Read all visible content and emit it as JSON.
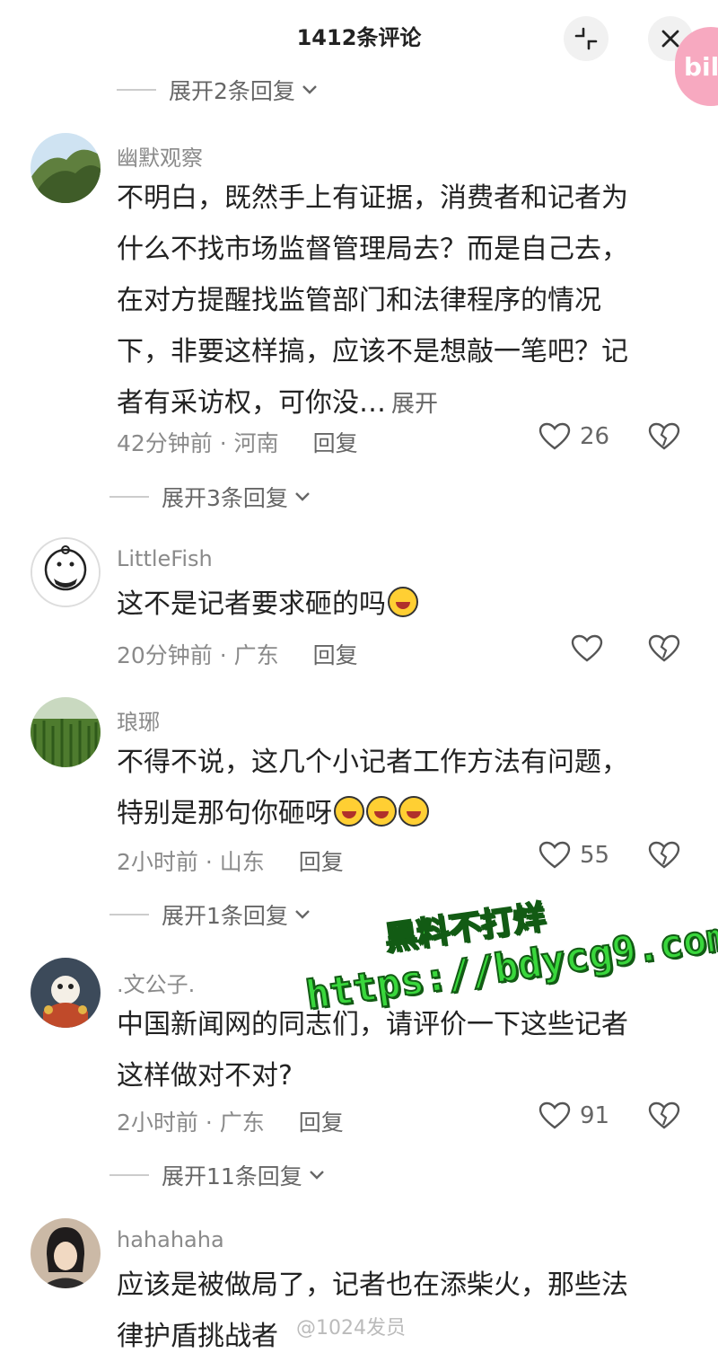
{
  "header": {
    "title": "1412条评论",
    "bili_badge": "bili"
  },
  "expand_labels": [
    "展开2条回复",
    "展开3条回复",
    "展开1条回复",
    "展开11条回复"
  ],
  "comments": [
    {
      "username": "幽默观察",
      "lines": [
        "不明白，既然手上有证据，消费者和记者为",
        "什么不找市场监督管理局去？而是自己去，",
        "在对方提醒找监管部门和法律程序的情况",
        "下，非要这样搞，应该不是想敲一笔吧？记",
        "者有采访权，可你没…"
      ],
      "more": "展开",
      "time": "42分钟前 · 河南",
      "reply": "回复",
      "likes": "26"
    },
    {
      "username": "LittleFish",
      "lines": [
        "这不是记者要求砸的吗"
      ],
      "time": "20分钟前 · 广东",
      "reply": "回复",
      "likes": ""
    },
    {
      "username": "琅琊",
      "lines": [
        "不得不说，这几个小记者工作方法有问题，",
        "特别是那句你砸呀"
      ],
      "time": "2小时前 · 山东",
      "reply": "回复",
      "likes": "55"
    },
    {
      "username": ".文公子.",
      "lines": [
        "中国新闻网的同志们，请评价一下这些记者",
        "这样做对不对?"
      ],
      "time": "2小时前 · 广东",
      "reply": "回复",
      "likes": "91"
    },
    {
      "username": "hahahaha",
      "lines": [
        "应该是被做局了，记者也在添柴火，那些法",
        "律护盾挑战者"
      ],
      "time": "",
      "reply": "",
      "likes": ""
    }
  ],
  "watermark": {
    "line1": "黑料不打烊",
    "line2": "https://bdycg9.com"
  },
  "weibo_watermark": "@1024发员",
  "colors": {
    "accent_watermark": "#39d73c",
    "bili_pink": "#f7a9c0"
  }
}
